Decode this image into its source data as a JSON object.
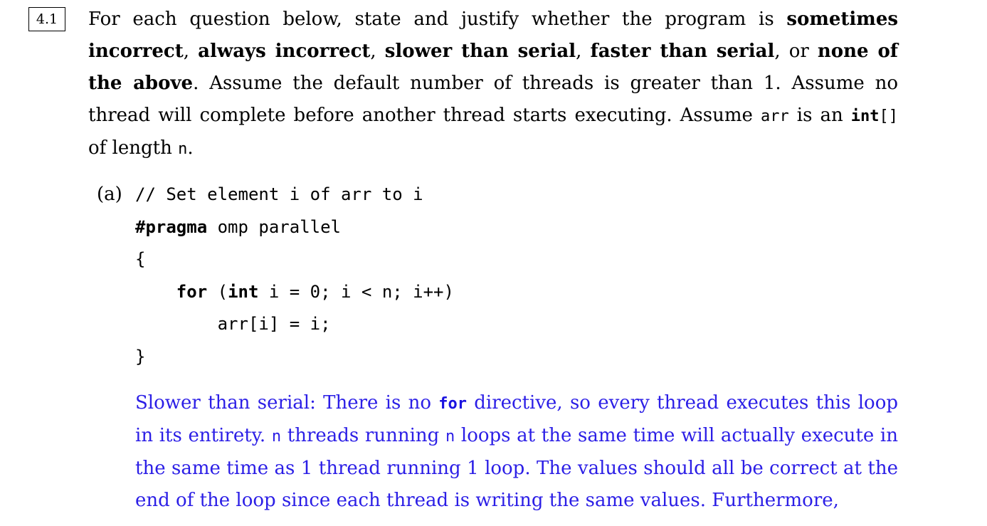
{
  "question": {
    "number": "4.1",
    "prompt": {
      "t1": "For each question below, state and justify whether the program is ",
      "b1": "sometimes incorrect",
      "t2": ", ",
      "b2": "always incorrect",
      "t3": ", ",
      "b3": "slower than serial",
      "t4": ", ",
      "b4": "faster than serial",
      "t5": ", or ",
      "b5": "none of the above",
      "t6": ". Assume the default number of threads is greater than 1. Assume no thread will complete before another thread starts executing. Assume ",
      "c1": "arr",
      "t7": " is an ",
      "c2": "int",
      "c3": "[]",
      "t8": " of length ",
      "c4": "n",
      "t9": "."
    }
  },
  "part_a": {
    "label": "(a)",
    "code": {
      "line1": "// Set element i of arr to i",
      "line2_kw": "#pragma",
      "line2_rest": " omp parallel",
      "line3": "{",
      "line4_indent": "    ",
      "line4_kw1": "for",
      "line4_mid": " (",
      "line4_kw2": "int",
      "line4_rest": " i = 0; i < n; i++)",
      "line5": "        arr[i] = i;",
      "line6": "}"
    },
    "answer": {
      "a1": "Slower than serial: There is no ",
      "a_kw": "for",
      "a2": " directive, so every thread executes this loop in its entirety. ",
      "a_n1": "n",
      "a3": " threads running ",
      "a_n2": "n",
      "a4": " loops at the same time will actually execute in the same time as 1 thread running 1 loop. The values should all be correct at the end of the loop since each thread is writing the same values. Furthermore,"
    }
  }
}
